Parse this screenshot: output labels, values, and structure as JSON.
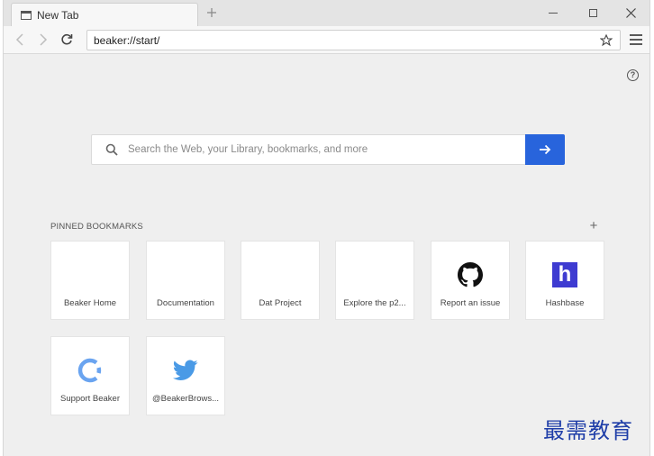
{
  "tab": {
    "title": "New Tab",
    "new_tab_icon": "plus-icon",
    "favicon": "window-icon"
  },
  "window_controls": {
    "minimize": "minimize-icon",
    "maximize": "maximize-icon",
    "close": "close-icon"
  },
  "nav": {
    "url": "beaker://start/",
    "back_icon": "chevron-left-icon",
    "forward_icon": "chevron-right-icon",
    "reload_icon": "reload-icon",
    "bookmark_icon": "star-icon",
    "menu_icon": "hamburger-icon"
  },
  "page": {
    "help_label": "?",
    "search": {
      "placeholder": "Search the Web, your Library, bookmarks, and more",
      "value": "",
      "submit_icon": "arrow-right-icon"
    },
    "pinned": {
      "heading": "PINNED BOOKMARKS",
      "add_label": "+",
      "items": [
        {
          "label": "Beaker Home",
          "icon": ""
        },
        {
          "label": "Documentation",
          "icon": ""
        },
        {
          "label": "Dat Project",
          "icon": ""
        },
        {
          "label": "Explore the p2...",
          "icon": ""
        },
        {
          "label": "Report an issue",
          "icon": "github-icon"
        },
        {
          "label": "Hashbase",
          "icon": "hashbase-icon",
          "glyph": "h"
        },
        {
          "label": "Support Beaker",
          "icon": "support-ring-icon"
        },
        {
          "label": "@BeakerBrows...",
          "icon": "twitter-icon"
        }
      ]
    }
  },
  "watermark": {
    "text": "最需教育"
  },
  "colors": {
    "accent": "#2864dc",
    "hashbase": "#3e3bd1",
    "twitter": "#4a9ae6",
    "support": "#6aa4f0"
  }
}
